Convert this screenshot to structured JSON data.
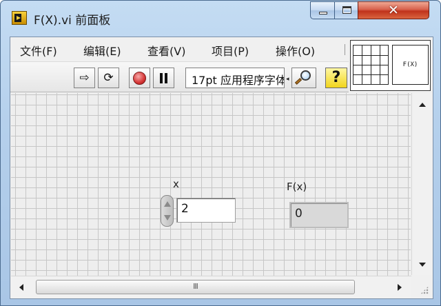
{
  "window": {
    "title": "F(X).vi 前面板",
    "close_glyph": "✕"
  },
  "menu": [
    {
      "label": "文件(F)"
    },
    {
      "label": "编辑(E)"
    },
    {
      "label": "查看(V)"
    },
    {
      "label": "项目(P)"
    },
    {
      "label": "操作(O)"
    }
  ],
  "toolbar": {
    "run_icon": "⇨",
    "run_continuous_icon": "⟳",
    "font_label": "17pt 应用程序字体",
    "help_label": "?"
  },
  "icon_pane": {
    "vi_icon_text": "F(X)"
  },
  "controls": {
    "x": {
      "label": "x",
      "value": "2"
    },
    "fx": {
      "label": "F(x)",
      "value": "0"
    }
  },
  "scrollbar": {
    "thumb_grip": "III"
  },
  "icons": [
    "app-icon",
    "minimize-icon",
    "maximize-icon",
    "close-icon",
    "run-arrow-icon",
    "run-continuous-icon",
    "abort-icon",
    "pause-icon",
    "search-icon",
    "help-icon",
    "connector-pane-icon",
    "vi-icon"
  ]
}
